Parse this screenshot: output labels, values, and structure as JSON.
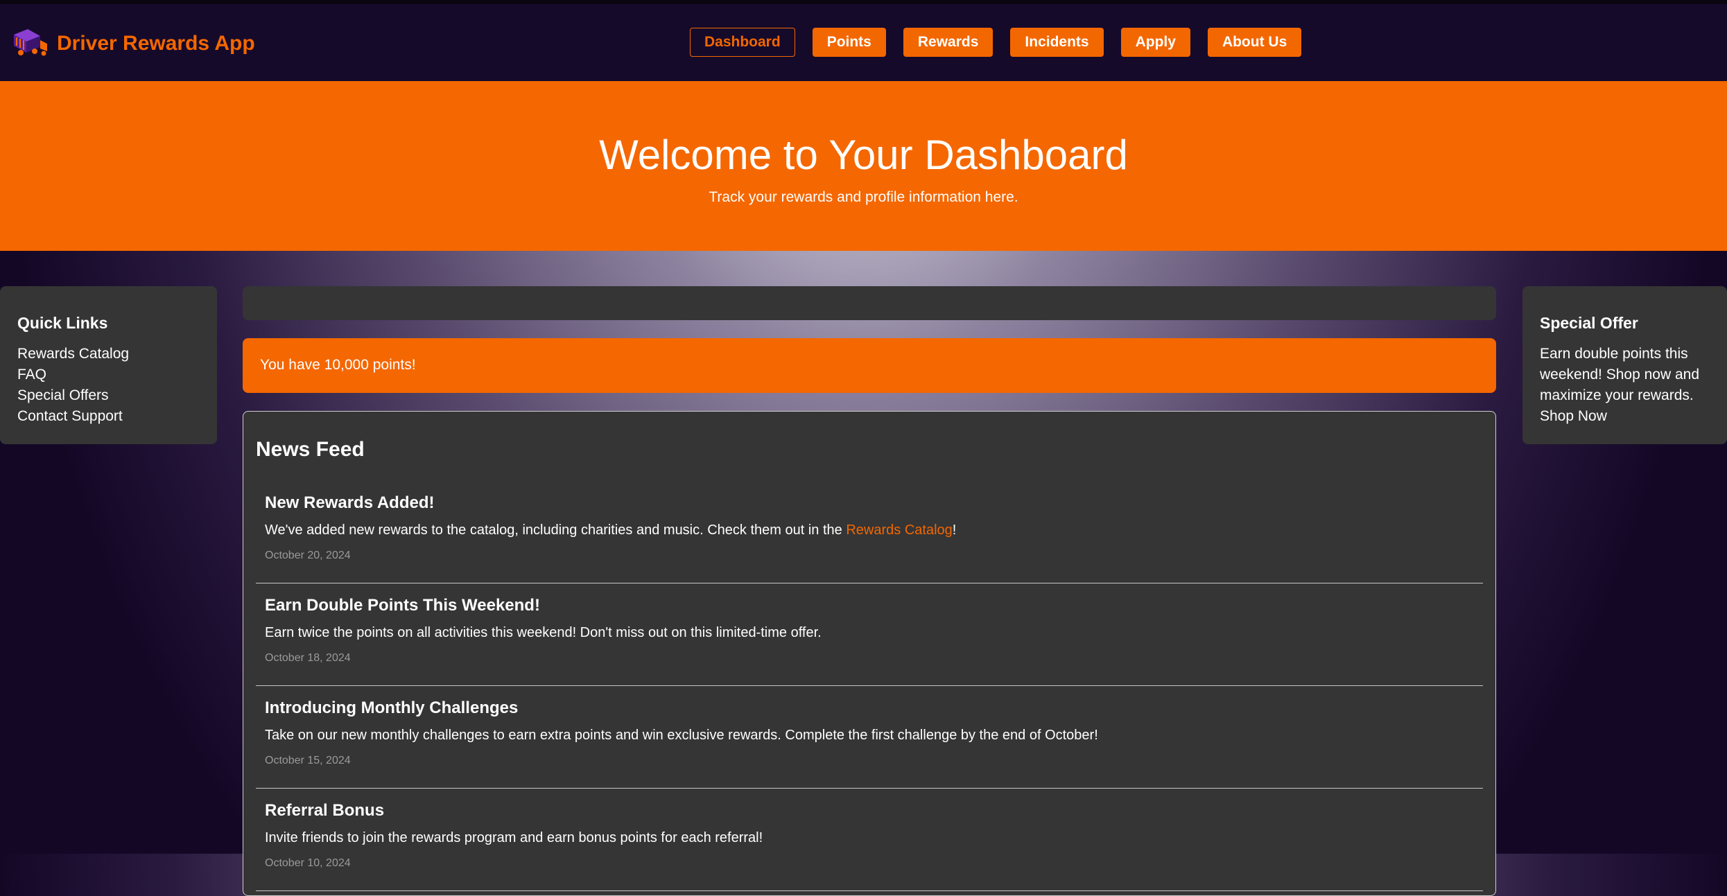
{
  "app": {
    "title": "Driver Rewards App"
  },
  "nav": {
    "items": [
      {
        "label": "Dashboard"
      },
      {
        "label": "Points"
      },
      {
        "label": "Rewards"
      },
      {
        "label": "Incidents"
      },
      {
        "label": "Apply"
      },
      {
        "label": "About Us"
      }
    ],
    "active": "Dashboard"
  },
  "hero": {
    "title": "Welcome to Your Dashboard",
    "subtitle": "Track your rewards and profile information here."
  },
  "quick_links": {
    "title": "Quick Links",
    "links": [
      "Rewards Catalog",
      "FAQ",
      "Special Offers",
      "Contact Support"
    ]
  },
  "special_offer": {
    "title": "Special Offer",
    "text": "Earn double points this weekend! Shop now and maximize your rewards.",
    "link": "Shop Now"
  },
  "points_banner": {
    "text": "You have 10,000 points!"
  },
  "news_feed": {
    "title": "News Feed",
    "items": [
      {
        "title": "New Rewards Added!",
        "body_before": "We've added new rewards to the catalog, including charities and music. Check them out in the ",
        "link": "Rewards Catalog",
        "body_after": "!",
        "date": "October 20, 2024"
      },
      {
        "title": "Earn Double Points This Weekend!",
        "body": "Earn twice the points on all activities this weekend! Don't miss out on this limited-time offer.",
        "date": "October 18, 2024"
      },
      {
        "title": "Introducing Monthly Challenges",
        "body": "Take on our new monthly challenges to earn extra points and win exclusive rewards. Complete the first challenge by the end of October!",
        "date": "October 15, 2024"
      },
      {
        "title": "Referral Bonus",
        "body": "Invite friends to join the rewards program and earn bonus points for each referral!",
        "date": "October 10, 2024"
      }
    ]
  },
  "colors": {
    "accent": "#f36700",
    "header_bg": "#160a2b",
    "panel_bg": "#353535"
  },
  "icons": {
    "brand": "truck-icon"
  }
}
